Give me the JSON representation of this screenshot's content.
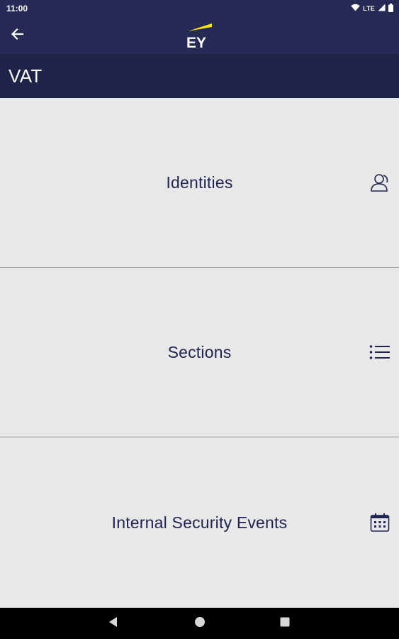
{
  "status_bar": {
    "time": "11:00",
    "network": "LTE",
    "icons": [
      "wifi-icon",
      "signal-icon",
      "battery-icon"
    ]
  },
  "app_bar": {
    "logo_text": "EY",
    "back_icon": "arrow-left-icon"
  },
  "header": {
    "title": "VAT"
  },
  "menu": {
    "items": [
      {
        "label": "Identities",
        "icon": "person-icon"
      },
      {
        "label": "Sections",
        "icon": "list-icon"
      },
      {
        "label": "Internal Security Events",
        "icon": "calendar-icon"
      }
    ]
  },
  "nav_bar": {
    "buttons": [
      "back-triangle-icon",
      "home-circle-icon",
      "recents-square-icon"
    ]
  },
  "colors": {
    "app_bar": "#252b55",
    "title_bar": "#1e2447",
    "background": "#e8e8e8",
    "text_primary": "#1f2452",
    "ey_yellow": "#ffe600"
  }
}
